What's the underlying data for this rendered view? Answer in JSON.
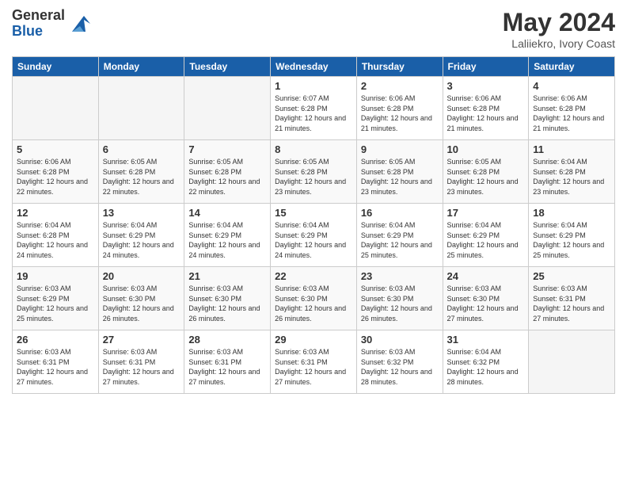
{
  "header": {
    "logo_general": "General",
    "logo_blue": "Blue",
    "month_title": "May 2024",
    "location": "Laliiekro, Ivory Coast"
  },
  "days_of_week": [
    "Sunday",
    "Monday",
    "Tuesday",
    "Wednesday",
    "Thursday",
    "Friday",
    "Saturday"
  ],
  "weeks": [
    [
      {
        "day": "",
        "empty": true
      },
      {
        "day": "",
        "empty": true
      },
      {
        "day": "",
        "empty": true
      },
      {
        "day": "1",
        "sunrise": "6:07 AM",
        "sunset": "6:28 PM",
        "daylight": "12 hours and 21 minutes."
      },
      {
        "day": "2",
        "sunrise": "6:06 AM",
        "sunset": "6:28 PM",
        "daylight": "12 hours and 21 minutes."
      },
      {
        "day": "3",
        "sunrise": "6:06 AM",
        "sunset": "6:28 PM",
        "daylight": "12 hours and 21 minutes."
      },
      {
        "day": "4",
        "sunrise": "6:06 AM",
        "sunset": "6:28 PM",
        "daylight": "12 hours and 21 minutes."
      }
    ],
    [
      {
        "day": "5",
        "sunrise": "6:06 AM",
        "sunset": "6:28 PM",
        "daylight": "12 hours and 22 minutes."
      },
      {
        "day": "6",
        "sunrise": "6:05 AM",
        "sunset": "6:28 PM",
        "daylight": "12 hours and 22 minutes."
      },
      {
        "day": "7",
        "sunrise": "6:05 AM",
        "sunset": "6:28 PM",
        "daylight": "12 hours and 22 minutes."
      },
      {
        "day": "8",
        "sunrise": "6:05 AM",
        "sunset": "6:28 PM",
        "daylight": "12 hours and 23 minutes."
      },
      {
        "day": "9",
        "sunrise": "6:05 AM",
        "sunset": "6:28 PM",
        "daylight": "12 hours and 23 minutes."
      },
      {
        "day": "10",
        "sunrise": "6:05 AM",
        "sunset": "6:28 PM",
        "daylight": "12 hours and 23 minutes."
      },
      {
        "day": "11",
        "sunrise": "6:04 AM",
        "sunset": "6:28 PM",
        "daylight": "12 hours and 23 minutes."
      }
    ],
    [
      {
        "day": "12",
        "sunrise": "6:04 AM",
        "sunset": "6:28 PM",
        "daylight": "12 hours and 24 minutes."
      },
      {
        "day": "13",
        "sunrise": "6:04 AM",
        "sunset": "6:29 PM",
        "daylight": "12 hours and 24 minutes."
      },
      {
        "day": "14",
        "sunrise": "6:04 AM",
        "sunset": "6:29 PM",
        "daylight": "12 hours and 24 minutes."
      },
      {
        "day": "15",
        "sunrise": "6:04 AM",
        "sunset": "6:29 PM",
        "daylight": "12 hours and 24 minutes."
      },
      {
        "day": "16",
        "sunrise": "6:04 AM",
        "sunset": "6:29 PM",
        "daylight": "12 hours and 25 minutes."
      },
      {
        "day": "17",
        "sunrise": "6:04 AM",
        "sunset": "6:29 PM",
        "daylight": "12 hours and 25 minutes."
      },
      {
        "day": "18",
        "sunrise": "6:04 AM",
        "sunset": "6:29 PM",
        "daylight": "12 hours and 25 minutes."
      }
    ],
    [
      {
        "day": "19",
        "sunrise": "6:03 AM",
        "sunset": "6:29 PM",
        "daylight": "12 hours and 25 minutes."
      },
      {
        "day": "20",
        "sunrise": "6:03 AM",
        "sunset": "6:30 PM",
        "daylight": "12 hours and 26 minutes."
      },
      {
        "day": "21",
        "sunrise": "6:03 AM",
        "sunset": "6:30 PM",
        "daylight": "12 hours and 26 minutes."
      },
      {
        "day": "22",
        "sunrise": "6:03 AM",
        "sunset": "6:30 PM",
        "daylight": "12 hours and 26 minutes."
      },
      {
        "day": "23",
        "sunrise": "6:03 AM",
        "sunset": "6:30 PM",
        "daylight": "12 hours and 26 minutes."
      },
      {
        "day": "24",
        "sunrise": "6:03 AM",
        "sunset": "6:30 PM",
        "daylight": "12 hours and 27 minutes."
      },
      {
        "day": "25",
        "sunrise": "6:03 AM",
        "sunset": "6:31 PM",
        "daylight": "12 hours and 27 minutes."
      }
    ],
    [
      {
        "day": "26",
        "sunrise": "6:03 AM",
        "sunset": "6:31 PM",
        "daylight": "12 hours and 27 minutes."
      },
      {
        "day": "27",
        "sunrise": "6:03 AM",
        "sunset": "6:31 PM",
        "daylight": "12 hours and 27 minutes."
      },
      {
        "day": "28",
        "sunrise": "6:03 AM",
        "sunset": "6:31 PM",
        "daylight": "12 hours and 27 minutes."
      },
      {
        "day": "29",
        "sunrise": "6:03 AM",
        "sunset": "6:31 PM",
        "daylight": "12 hours and 27 minutes."
      },
      {
        "day": "30",
        "sunrise": "6:03 AM",
        "sunset": "6:32 PM",
        "daylight": "12 hours and 28 minutes."
      },
      {
        "day": "31",
        "sunrise": "6:04 AM",
        "sunset": "6:32 PM",
        "daylight": "12 hours and 28 minutes."
      },
      {
        "day": "",
        "empty": true
      }
    ]
  ]
}
